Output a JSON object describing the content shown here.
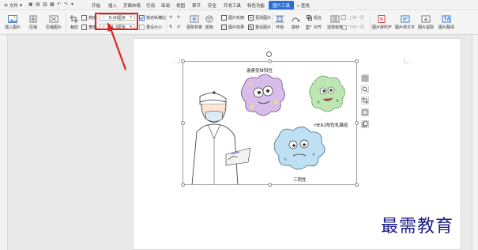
{
  "menubar": {
    "file_label": "文件",
    "tabs": [
      "开始",
      "插入",
      "页面布局",
      "引用",
      "审阅",
      "视图",
      "章节",
      "安全",
      "开发工具",
      "特色功能",
      "图片工具"
    ],
    "active_tab": "图片工具",
    "search_label": "查找"
  },
  "ribbon": {
    "insert_picture": "插入图片",
    "compress": "压缩",
    "compress_picture": "压缩图片",
    "crop": "裁剪",
    "height_label": "高度:",
    "height_value": "8.00厘米",
    "width_label": "宽度:",
    "width_value": "11.3厘米",
    "lock_ratio": "锁定纵横比",
    "reset_size": "重设大小",
    "remove_bg": "抠除背景",
    "color": "颜色",
    "picture_outline": "图片轮廓",
    "picture_effect": "图片效果",
    "change_picture": "更改图片",
    "reset_picture": "重设图片",
    "wrap": "环绕",
    "rotate": "旋转",
    "combine": "组合",
    "align": "对齐",
    "selection_pane": "选择窗格",
    "bring_forward": "上移一层",
    "send_backward": "下移一层",
    "pic_to_pdf": "图片转PDF",
    "pic_to_text": "图片转文字",
    "pic_extract": "图片提取",
    "pic_translate": "图片翻译"
  },
  "captions": {
    "hormone": "激素受体阳性",
    "her2": "HER2阳性乳腺癌",
    "triple": "三阴性"
  },
  "brand": "最需教育",
  "colors": {
    "accent": "#2b6fd6",
    "highlight": "#e02222",
    "brand": "#1b1b8c"
  }
}
